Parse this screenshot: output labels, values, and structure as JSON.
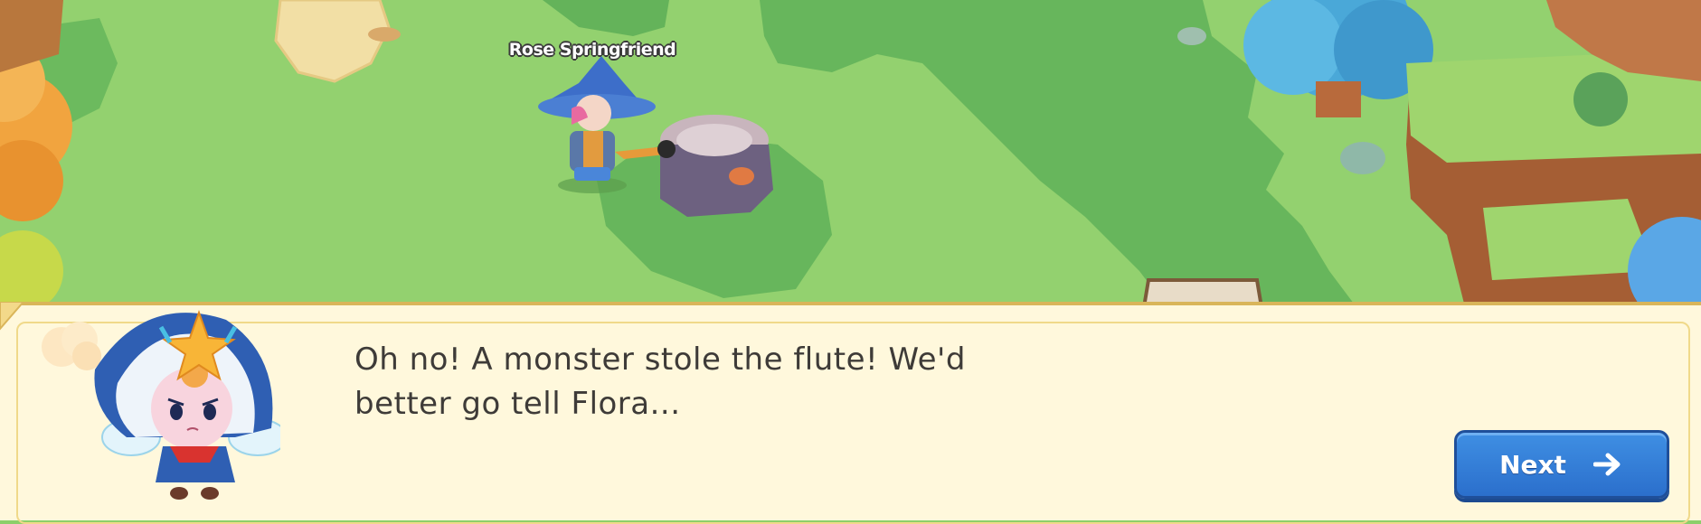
{
  "scene": {
    "player_name": "Rose Springfriend"
  },
  "dialog": {
    "text_line1": "Oh no! A monster stole the flute! We'd",
    "text_line2": "better go tell Flora...",
    "next_label": "Next",
    "next_icon": "arrow-right-icon"
  },
  "colors": {
    "grass": "#8ccf6a",
    "dark_grass": "#5fae58",
    "dialog_bg": "#fff8dc",
    "button_blue": "#2b6fcc"
  }
}
